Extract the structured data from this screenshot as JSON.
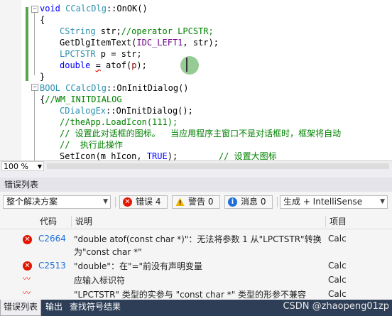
{
  "editor": {
    "lines": [
      {
        "top": "void CCalcDlg::OnOK()"
      },
      {
        "brace_open": "{"
      },
      {
        "l3": "CString str;//operator LPCSTR;"
      },
      {
        "l4": "GetDlgItemText(IDC_LEFT1, str);"
      },
      {
        "l5": "LPCTSTR p = str;"
      },
      {
        "l6": "double = atof(p);"
      },
      {
        "brace_close": "}"
      }
    ],
    "code": {
      "fn1_void": "void",
      "fn1_class": "CCalcDlg",
      "fn1_rest": "::OnOK()",
      "open_brace": "{",
      "l3_type": "CString",
      "l3_rest": " str;",
      "l3_comment": "//operator LPCSTR;",
      "l4_fn": "GetDlgItemText(",
      "l4_macro": "IDC_LEFT1",
      "l4_rest": ", str);",
      "l5_type": "LPCTSTR",
      "l5_rest": " p = str;",
      "l6_kw": "double",
      "l6_eq": "=",
      "l6_rest": " atof(",
      "l6_arg": "p",
      "l6_end": ");",
      "close_brace": "}",
      "fn2_bool": "BOOL",
      "fn2_class": "CCalcDlg",
      "fn2_rest": "::OnInitDialog()",
      "fn2_brace": "{",
      "fn2_comment": "//WM_INITDIALOG",
      "l9_class": "CDialogEx",
      "l9_rest": "::OnInitDialog();",
      "l10": "//theApp.LoadIcon(111);",
      "l11": "// 设置此对话框的图标。  当应用程序主窗口不是对话框时，框架将自动",
      "l12": "//  执行此操作",
      "l13_fn": "SetIcon(m_hIcon, ",
      "l13_kw": "TRUE",
      "l13_rest": ");",
      "l13_comment": "// 设置大图标"
    },
    "zoom": "100 %"
  },
  "error_list": {
    "title": "错误列表",
    "scope_combo": "整个解决方案",
    "errors_btn": "错误 4",
    "warnings_btn": "警告 0",
    "messages_btn": "消息 0",
    "build_combo": "生成 + IntelliSense",
    "columns": {
      "code": "代码",
      "description": "说明",
      "project": "项目"
    },
    "rows": [
      {
        "icon": "error-icon",
        "code": "C2664",
        "description": "\"double atof(const char *)\"：无法将参数 1 从\"LPCTSTR\"转换为\"const char *\"",
        "project": "Calc"
      },
      {
        "icon": "error-icon",
        "code": "C2513",
        "description": "\"double\"：在\"=\"前没有声明变量",
        "project": "Calc"
      },
      {
        "icon": "intellisense-error-icon",
        "code": "",
        "description": "应输入标识符",
        "project": "Calc"
      },
      {
        "icon": "intellisense-error-icon",
        "code": "",
        "description": "\"LPCTSTR\" 类型的实参与 \"const char *\" 类型的形参不兼容",
        "project": "Calc"
      }
    ]
  },
  "bottom_tabs": [
    {
      "label": "错误列表"
    },
    {
      "label": "输出"
    },
    {
      "label": "查找符号结果"
    }
  ],
  "watermark": "CSDN @zhaopeng01zp",
  "colors": {
    "error": "#e51400",
    "warning": "#f0b400",
    "info": "#1e6fd9",
    "tabbar": "#2d3e56"
  }
}
